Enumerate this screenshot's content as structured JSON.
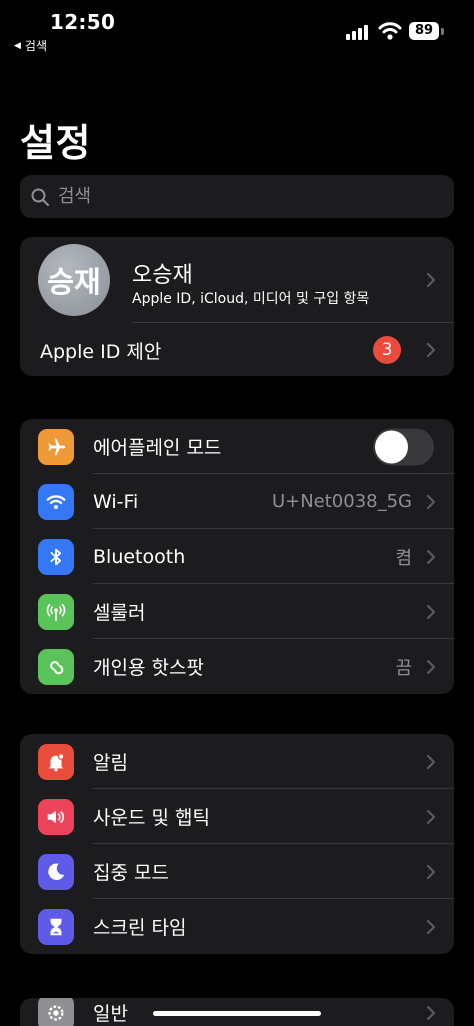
{
  "status_bar": {
    "time": "12:50",
    "back_label": "검색",
    "battery": "89"
  },
  "title": "설정",
  "search": {
    "placeholder": "검색"
  },
  "account": {
    "avatar_initials": "승재",
    "name": "오승재",
    "subtitle": "Apple ID, iCloud, 미디어 및 구입 항목",
    "suggestions_label": "Apple ID 제안",
    "suggestions_badge": "3"
  },
  "connectivity": [
    {
      "label": "에어플레인 모드",
      "type": "toggle",
      "toggle_on": false,
      "icon": "airplane-icon",
      "color": "#f09a37"
    },
    {
      "label": "Wi-Fi",
      "value": "U+Net0038_5G",
      "icon": "wifi-icon",
      "color": "#3478f6"
    },
    {
      "label": "Bluetooth",
      "value": "켬",
      "icon": "bluetooth-icon",
      "color": "#3478f6"
    },
    {
      "label": "셀룰러",
      "value": "",
      "icon": "cellular-icon",
      "color": "#5ac35a"
    },
    {
      "label": "개인용 핫스팟",
      "value": "끔",
      "icon": "hotspot-icon",
      "color": "#5ac35a"
    }
  ],
  "notifications": [
    {
      "label": "알림",
      "icon": "bell-icon",
      "color": "#eb4d3d"
    },
    {
      "label": "사운드 및 햅틱",
      "icon": "speaker-icon",
      "color": "#eb445a"
    },
    {
      "label": "집중 모드",
      "icon": "moon-icon",
      "color": "#5e5ce6"
    },
    {
      "label": "스크린 타임",
      "icon": "hourglass-icon",
      "color": "#5e5ce6"
    }
  ],
  "general": [
    {
      "label": "일반",
      "icon": "gear-icon",
      "color": "#8e8e93"
    }
  ]
}
